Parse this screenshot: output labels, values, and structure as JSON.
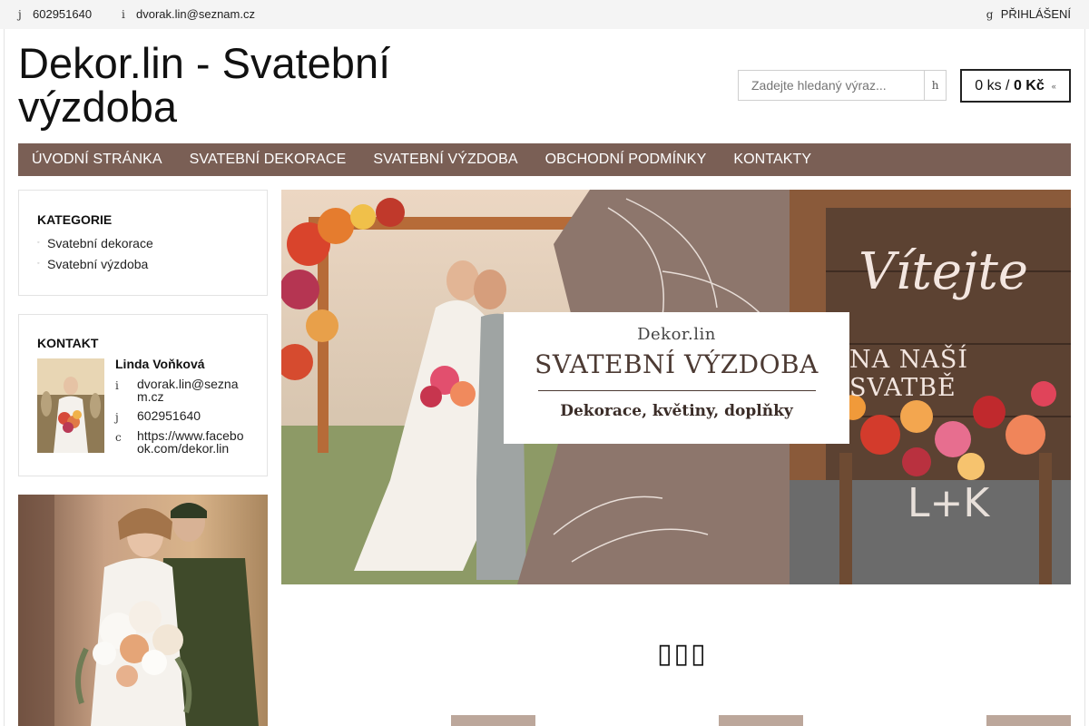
{
  "topbar": {
    "phone_icon": "j",
    "phone": "602951640",
    "email_icon": "i",
    "email": "dvorak.lin@seznam.cz",
    "login_icon": "g",
    "login_label": "PŘIHLÁŠENÍ"
  },
  "header": {
    "title": "Dekor.lin - Svatební výzdoba",
    "search_placeholder": "Zadejte hledaný výraz...",
    "search_button_icon": "h",
    "cart": {
      "count_text": "0 ks /",
      "price_text": "0 Kč",
      "arrow": "«"
    }
  },
  "nav": {
    "items": [
      {
        "label": "ÚVODNÍ STRÁNKA"
      },
      {
        "label": "SVATEBNÍ DEKORACE"
      },
      {
        "label": "SVATEBNÍ VÝZDOBA"
      },
      {
        "label": "OBCHODNÍ PODMÍNKY"
      },
      {
        "label": "KONTAKTY"
      }
    ]
  },
  "sidebar": {
    "categories": {
      "heading": "KATEGORIE",
      "items": [
        {
          "label": "Svatební dekorace"
        },
        {
          "label": "Svatební výzdoba"
        }
      ]
    },
    "contact": {
      "heading": "KONTAKT",
      "name": "Linda Voňková",
      "email_icon": "i",
      "email": "dvorak.lin@seznam.cz",
      "phone_icon": "j",
      "phone": "602951640",
      "facebook_icon": "c",
      "facebook": "https://www.facebook.com/dekor.lin"
    }
  },
  "banner": {
    "brand": "Dekor.lin",
    "title": "SVATEBNÍ VÝZDOBA",
    "subtitle": "Dekorace, květiny, doplňky",
    "sign_text_1": "Vítejte",
    "sign_text_2": "NA NAŠÍ SVATBĚ",
    "sign_text_3": "L+K"
  },
  "slider": {
    "dots": "▯▯▯"
  },
  "colors": {
    "nav_bg": "#7a5f55",
    "topbar_bg": "#f4f4f4",
    "banner_brown": "#8d766c"
  }
}
